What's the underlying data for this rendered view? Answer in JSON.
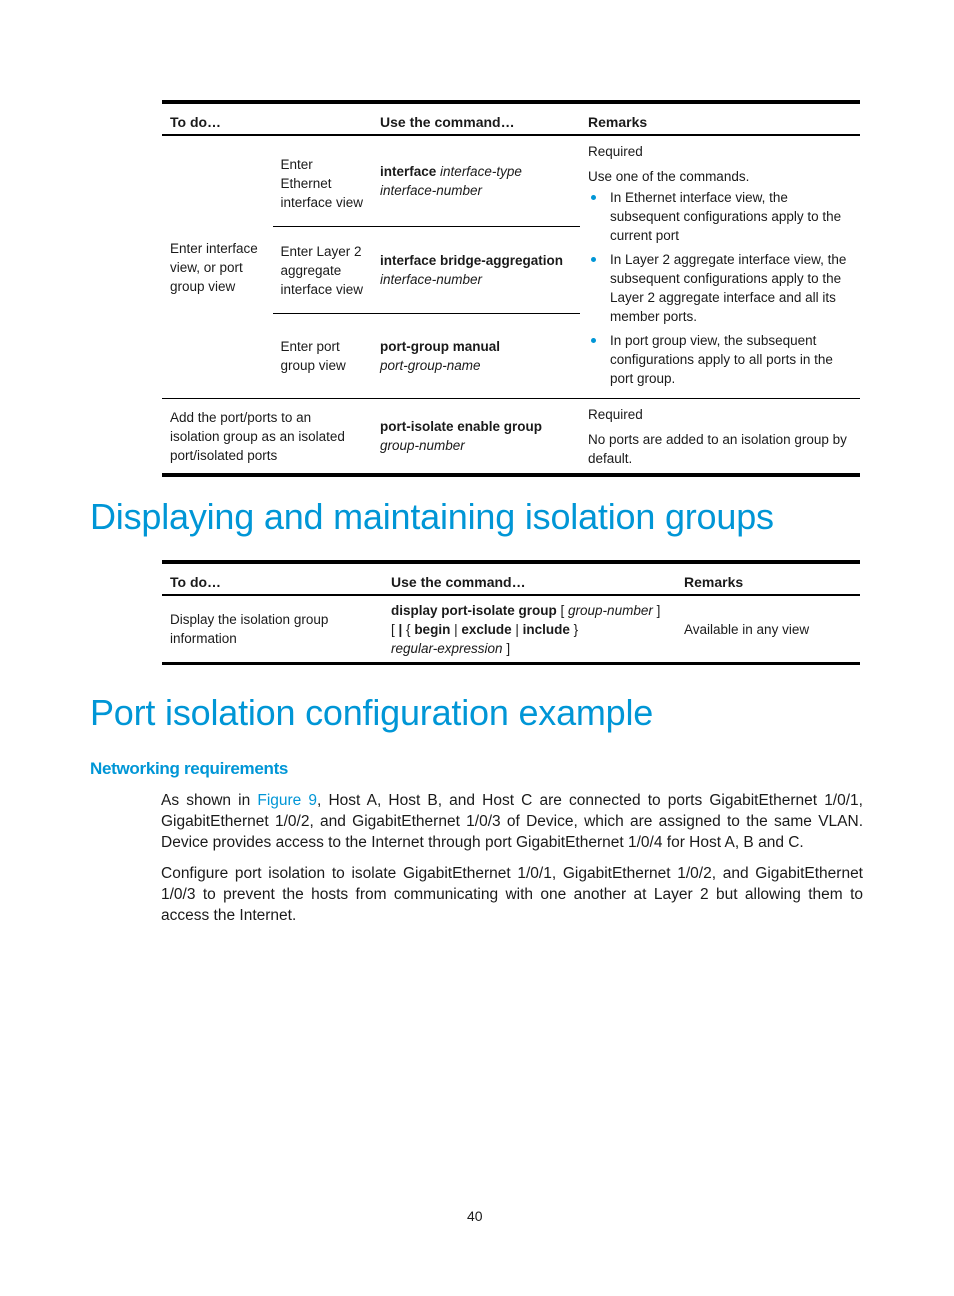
{
  "table1": {
    "headers": {
      "todo": "To do…",
      "command": "Use the command…",
      "remarks": "Remarks"
    },
    "group_task": "Enter interface view, or port group view",
    "sub_rows": [
      {
        "task": "Enter Ethernet interface view",
        "cmd_bold": "interface",
        "cmd_italic1": "interface-type",
        "cmd_italic2": "interface-number"
      },
      {
        "task": "Enter Layer 2 aggregate interface view",
        "cmd_bold": "interface bridge-aggregation",
        "cmd_italic2": "interface-number"
      },
      {
        "task": "Enter port group view",
        "cmd_bold": "port-group manual",
        "cmd_italic2": "port-group-name"
      }
    ],
    "group_remarks": {
      "line1": "Required",
      "line2": "Use one of the commands.",
      "bullets": [
        "In Ethernet interface view, the subsequent configurations apply to the current port",
        "In Layer 2 aggregate interface view, the subsequent configurations apply to the Layer 2 aggregate interface and all its member ports.",
        "In port group view, the subsequent configurations apply to all ports in the port group."
      ]
    },
    "row2": {
      "task": "Add the port/ports to an isolation group as an isolated port/isolated ports",
      "cmd_bold": "port-isolate enable group",
      "cmd_italic": "group-number",
      "remarks_line1": "Required",
      "remarks_line2": "No ports are added to an isolation group by default."
    }
  },
  "section1": {
    "title": "Displaying and maintaining isolation groups"
  },
  "table2": {
    "headers": {
      "todo": "To do…",
      "command": "Use the command…",
      "remarks": "Remarks"
    },
    "row": {
      "task": "Display the isolation group information",
      "cmd": {
        "p1_bold": "display port-isolate group",
        "p2": " [ ",
        "p3_italic": "group-number",
        "p4": " ]",
        "p5": "[ ",
        "p6_bold": "|",
        "p7": " { ",
        "p8_bold": "begin",
        "p9": " | ",
        "p10_bold": "exclude",
        "p11": " | ",
        "p12_bold": "include",
        "p13": " }",
        "p14_italic": "regular-expression",
        "p15": " ]"
      },
      "remarks": "Available in any view"
    }
  },
  "section2": {
    "title": "Port isolation configuration example"
  },
  "subsection": {
    "title": "Networking requirements"
  },
  "paragraph1": {
    "before_link": "As shown in ",
    "link": "Figure 9",
    "after_link": ", Host A, Host B, and Host C are connected to ports GigabitEthernet 1/0/1, GigabitEthernet 1/0/2, and GigabitEthernet 1/0/3 of Device, which are assigned to the same VLAN. Device provides access to the Internet through port GigabitEthernet 1/0/4 for Host A, B and C."
  },
  "paragraph2": "Configure port isolation to isolate GigabitEthernet 1/0/1, GigabitEthernet 1/0/2, and GigabitEthernet 1/0/3 to prevent the hosts from communicating with one another at Layer 2 but allowing them to access the Internet.",
  "page_number": "40"
}
